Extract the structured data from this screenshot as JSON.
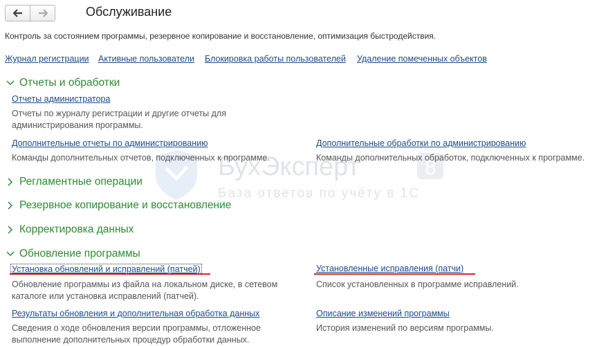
{
  "header": {
    "title": "Обслуживание",
    "back_icon": "arrow-left-icon",
    "forward_icon": "arrow-right-icon"
  },
  "description": "Контроль за состоянием программы, резервное копирование и восстановление, оптимизация быстродействия.",
  "top_links": [
    "Журнал регистрации",
    "Активные пользователи",
    "Блокировка работы пользователей",
    "Удаление помеченных объектов"
  ],
  "groups": {
    "reports": {
      "title": "Отчеты и обработки",
      "admin_reports_link": "Отчеты администратора",
      "admin_reports_text": "Отчеты по журналу регистрации и другие отчеты для администрирования программы.",
      "extra_reports_link": "Дополнительные отчеты по администрированию",
      "extra_reports_text": "Команды дополнительных отчетов, подключенных к программе.",
      "extra_processing_link": "Дополнительные обработки по администрированию",
      "extra_processing_text": "Команды дополнительных обработок, подключенных к программе."
    },
    "scheduled": {
      "title": "Регламентные операции"
    },
    "backup": {
      "title": "Резервное копирование и восстановление"
    },
    "correction": {
      "title": "Корректировка данных"
    },
    "update": {
      "title": "Обновление программы",
      "install_link": "Установка обновлений и исправлений (патчей)",
      "install_text": "Обновление программы из файла на локальном диске, в сетевом каталоге или установка исправлений (патчей).",
      "installed_link": "Установленные исправления (патчи)",
      "installed_text": "Список установленных в программе исправлений.",
      "results_link": "Результаты обновления и дополнительная обработка данных",
      "results_text": "Сведения о ходе обновления версии программы, отложенное выполнение дополнительных процедур обработки данных.",
      "changes_link": "Описание изменений программы",
      "changes_text": "История изменений по версиям программы."
    }
  },
  "watermark": {
    "name": "БухЭксперт",
    "badge": "8",
    "tagline": "База ответов по учёту в 1С"
  },
  "colors": {
    "group_title": "#2d8a33",
    "link": "#1a4b8c",
    "highlight_underline": "#e0201a"
  }
}
